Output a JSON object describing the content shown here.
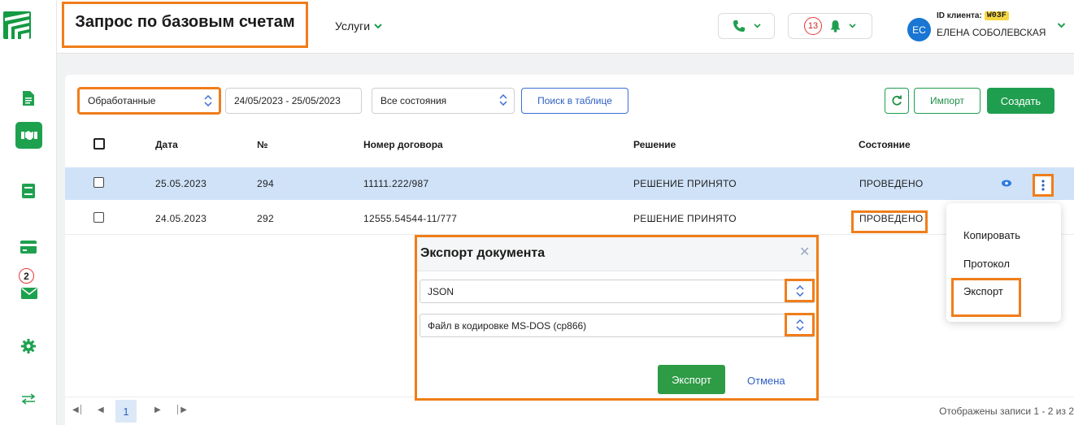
{
  "header": {
    "title": "Запрос по базовым счетам",
    "services_label": "Услуги",
    "notifications_count": "13",
    "user": {
      "initials": "ЕС",
      "client_id_label": "ID клиента:",
      "client_id": "W03F",
      "name": "ЕЛЕНА СОБОЛЕВСКАЯ"
    }
  },
  "sidebar": {
    "items": [
      {
        "icon": "document-icon"
      },
      {
        "icon": "handshake-icon",
        "active": true
      },
      {
        "icon": "book-icon"
      },
      {
        "icon": "card-icon"
      },
      {
        "icon": "mail-icon",
        "badge": "2"
      },
      {
        "icon": "gear-icon"
      },
      {
        "icon": "transfer-icon"
      }
    ]
  },
  "toolbar": {
    "filter_value": "Обработанные",
    "date_range": "24/05/2023 - 25/05/2023",
    "state_filter": "Все состояния",
    "search_label": "Поиск в таблице",
    "import_label": "Импорт",
    "create_label": "Создать"
  },
  "table": {
    "columns": [
      "Дата",
      "№",
      "Номер договора",
      "Решение",
      "Состояние"
    ],
    "rows": [
      {
        "date": "25.05.2023",
        "num": "294",
        "contract": "11111.222/987",
        "decision": "РЕШЕНИЕ ПРИНЯТО",
        "state": "ПРОВЕДЕНО"
      },
      {
        "date": "24.05.2023",
        "num": "292",
        "contract": "12555.54544-11/777",
        "decision": "РЕШЕНИЕ ПРИНЯТО",
        "state": "ПРОВЕДЕНО"
      }
    ]
  },
  "context_menu": {
    "items": [
      "Копировать",
      "Протокол",
      "Экспорт"
    ]
  },
  "modal": {
    "title": "Экспорт документа",
    "format_value": "JSON",
    "encoding_value": "Файл в кодировке MS-DOS (cp866)",
    "export_label": "Экспорт",
    "cancel_label": "Отмена"
  },
  "pager": {
    "current_page": "1",
    "info": "Отображены записи 1 - 2 из 2"
  },
  "colors": {
    "brand_green": "#1f9e4f",
    "highlight_orange": "#f07d1a",
    "selected_row": "#cfe2f8",
    "link_blue": "#2d5ec4"
  }
}
